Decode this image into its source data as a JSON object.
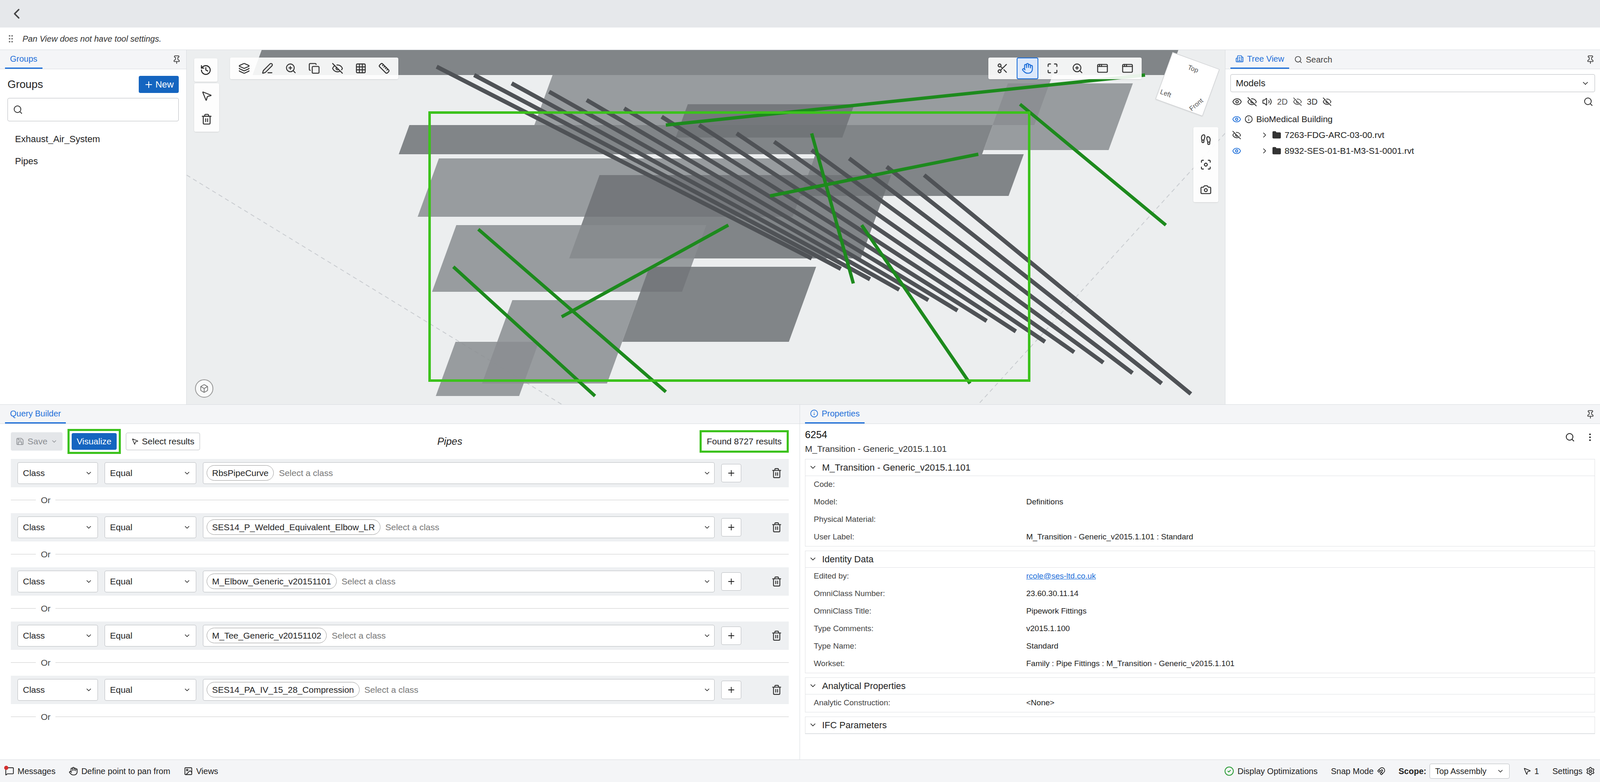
{
  "app": {
    "tool_settings": "Pan View does not have tool settings."
  },
  "groups_panel": {
    "tab": "Groups",
    "title": "Groups",
    "new_button": "New",
    "search_placeholder": "",
    "items": [
      {
        "label": "Exhaust_Air_System",
        "selected": false
      },
      {
        "label": "Pipes",
        "selected": false
      }
    ]
  },
  "viewport": {
    "highlight_box": true,
    "pan_active": true,
    "cube_faces": [
      "Top",
      "Left",
      "Front"
    ]
  },
  "tree_panel": {
    "tabs": [
      {
        "label": "Tree View",
        "selected": true
      },
      {
        "label": "Search",
        "selected": false
      }
    ],
    "dropdown": "Models",
    "view_toggles": [
      "2D",
      "3D"
    ],
    "nodes": [
      {
        "label": "BioMedical Building",
        "visible": true,
        "level": 0,
        "expandable": false
      },
      {
        "label": "7263-FDG-ARC-03-00.rvt",
        "visible": false,
        "level": 1,
        "expandable": true
      },
      {
        "label": "8932-SES-01-B1-M3-S1-0001.rvt",
        "visible": true,
        "level": 1,
        "expandable": true
      }
    ]
  },
  "query_builder": {
    "tab": "Query Builder",
    "save": "Save",
    "visualize": "Visualize",
    "visualize_highlighted": true,
    "select_results": "Select results",
    "title": "Pipes",
    "results": "Found 8727 results",
    "results_highlighted": true,
    "separator": "Or",
    "rows": [
      {
        "field": "Class",
        "operator": "Equal",
        "value": "RbsPipeCurve",
        "placeholder": "Select a class"
      },
      {
        "field": "Class",
        "operator": "Equal",
        "value": "SES14_P_Welded_Equivalent_Elbow_LR",
        "placeholder": "Select a class"
      },
      {
        "field": "Class",
        "operator": "Equal",
        "value": "M_Elbow_Generic_v20151101",
        "placeholder": "Select a class"
      },
      {
        "field": "Class",
        "operator": "Equal",
        "value": "M_Tee_Generic_v20151102",
        "placeholder": "Select a class"
      },
      {
        "field": "Class",
        "operator": "Equal",
        "value": "SES14_PA_IV_15_28_Compression",
        "placeholder": "Select a class"
      }
    ]
  },
  "properties": {
    "tab": "Properties",
    "id": "6254",
    "subtitle": "M_Transition - Generic_v2015.1.101",
    "sections": [
      {
        "title": "M_Transition - Generic_v2015.1.101",
        "expanded": true,
        "rows": [
          {
            "label": "Code:",
            "value": "",
            "kind": "text"
          },
          {
            "label": "Model:",
            "value": "Definitions",
            "kind": "text"
          },
          {
            "label": "Physical Material:",
            "value": "",
            "kind": "text"
          },
          {
            "label": "User Label:",
            "value": "M_Transition - Generic_v2015.1.101 : Standard",
            "kind": "text"
          }
        ]
      },
      {
        "title": "Identity Data",
        "expanded": true,
        "rows": [
          {
            "label": "Edited by:",
            "value": "rcole@ses-ltd.co.uk",
            "kind": "link"
          },
          {
            "label": "OmniClass Number:",
            "value": "23.60.30.11.14",
            "kind": "text"
          },
          {
            "label": "OmniClass Title:",
            "value": "Pipework Fittings",
            "kind": "text"
          },
          {
            "label": "Type Comments:",
            "value": "v2015.1.100",
            "kind": "text"
          },
          {
            "label": "Type Name:",
            "value": "Standard",
            "kind": "text"
          },
          {
            "label": "Workset:",
            "value": "Family : Pipe Fittings : M_Transition - Generic_v2015.1.101",
            "kind": "text"
          }
        ]
      },
      {
        "title": "Analytical Properties",
        "expanded": true,
        "rows": [
          {
            "label": "Analytic Construction:",
            "value": "<None>",
            "kind": "text"
          }
        ]
      },
      {
        "title": "IFC Parameters",
        "expanded": true,
        "rows": []
      }
    ]
  },
  "status_bar": {
    "messages": "Messages",
    "messages_alert": true,
    "tool": "Define point to pan from",
    "views": "Views",
    "display": "Display Optimizations",
    "snap": "Snap Mode",
    "scope_label": "Scope:",
    "scope": "Top Assembly",
    "selection_count": "1",
    "settings": "Settings"
  }
}
